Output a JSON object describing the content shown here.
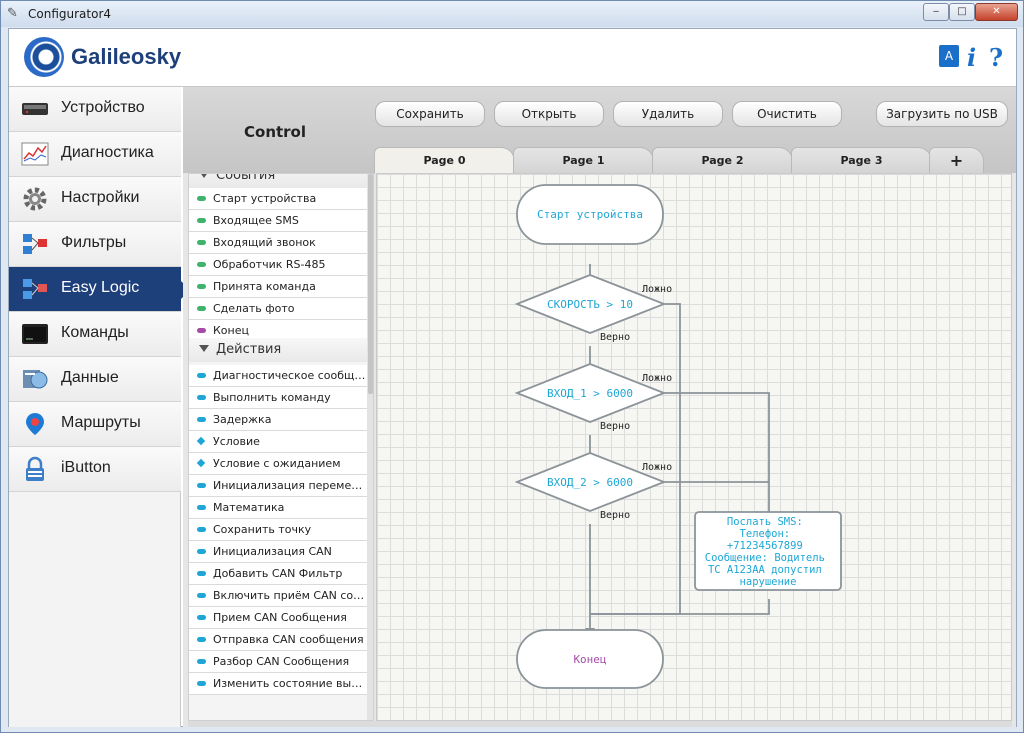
{
  "window": {
    "title": "Configurator4",
    "controls": {
      "minimize": "‒",
      "maximize": "□",
      "close": "✕"
    }
  },
  "header": {
    "logo_text": "Galileosky",
    "language_icon": "A",
    "info_icon": "i",
    "help_icon": "?"
  },
  "sidebar": {
    "items": [
      {
        "label": "Устройство",
        "icon": "device-icon"
      },
      {
        "label": "Диагностика",
        "icon": "diagnostics-icon"
      },
      {
        "label": "Настройки",
        "icon": "gear-icon"
      },
      {
        "label": "Фильтры",
        "icon": "filters-icon"
      },
      {
        "label": "Easy Logic",
        "icon": "easy-logic-icon",
        "active": true
      },
      {
        "label": "Команды",
        "icon": "terminal-icon"
      },
      {
        "label": "Данные",
        "icon": "data-icon"
      },
      {
        "label": "Маршруты",
        "icon": "map-pin-icon"
      },
      {
        "label": "iButton",
        "icon": "lock-icon"
      }
    ],
    "active_color": "#1d3f7a"
  },
  "main": {
    "title": "Control",
    "buttons": {
      "save": "Сохранить",
      "open": "Открыть",
      "delete": "Удалить",
      "clear": "Очистить",
      "upload_usb": "Загрузить по USB"
    },
    "tabs": [
      {
        "label": "Page 0",
        "active": true
      },
      {
        "label": "Page 1"
      },
      {
        "label": "Page 2"
      },
      {
        "label": "Page 3"
      },
      {
        "label": "+"
      }
    ]
  },
  "palette": {
    "events_header": "События",
    "events": [
      {
        "label": "Старт устройства",
        "color": "#3fb36b"
      },
      {
        "label": "Входящее SMS",
        "color": "#3fb36b"
      },
      {
        "label": "Входящий звонок",
        "color": "#3fb36b"
      },
      {
        "label": "Обработчик RS-485",
        "color": "#3fb36b"
      },
      {
        "label": "Принята команда",
        "color": "#3fb36b"
      },
      {
        "label": "Сделать фото",
        "color": "#3fb36b"
      },
      {
        "label": "Конец",
        "color": "#a64ca6"
      }
    ],
    "actions_header": "Действия",
    "actions": [
      {
        "label": "Диагностическое сообщ…",
        "shape": "dot"
      },
      {
        "label": "Выполнить команду",
        "shape": "dot"
      },
      {
        "label": "Задержка",
        "shape": "dot"
      },
      {
        "label": "Условие",
        "shape": "diamond"
      },
      {
        "label": "Условие с ожиданием",
        "shape": "diamond"
      },
      {
        "label": "Инициализация переме…",
        "shape": "dot"
      },
      {
        "label": "Математика",
        "shape": "dot"
      },
      {
        "label": "Сохранить точку",
        "shape": "dot"
      },
      {
        "label": "Инициализация CAN",
        "shape": "dot"
      },
      {
        "label": "Добавить CAN Фильтр",
        "shape": "dot"
      },
      {
        "label": "Включить приём CAN со…",
        "shape": "dot"
      },
      {
        "label": "Прием CAN Сообщения",
        "shape": "dot"
      },
      {
        "label": "Отправка CAN сообщения",
        "shape": "dot"
      },
      {
        "label": "Разбор CAN Сообщения",
        "shape": "dot"
      },
      {
        "label": "Изменить состояние вы…",
        "shape": "dot"
      }
    ],
    "action_color": "#1ea7d6"
  },
  "flowchart": {
    "start": "Старт устройства",
    "cond1": "СКОРОСТЬ > 10",
    "cond2": "ВХОД_1 > 6000",
    "cond3": "ВХОД_2 > 6000",
    "false_label": "Ложно",
    "true_label": "Верно",
    "sms_lines": [
      "Послать SMS:",
      "Телефон:",
      "+71234567899",
      "Сообщение: Водитель",
      "ТС А123АА допустил",
      "нарушение"
    ],
    "end": "Конец",
    "node_text_color": "#1ea7d6",
    "end_text_color": "#a64ca6"
  }
}
